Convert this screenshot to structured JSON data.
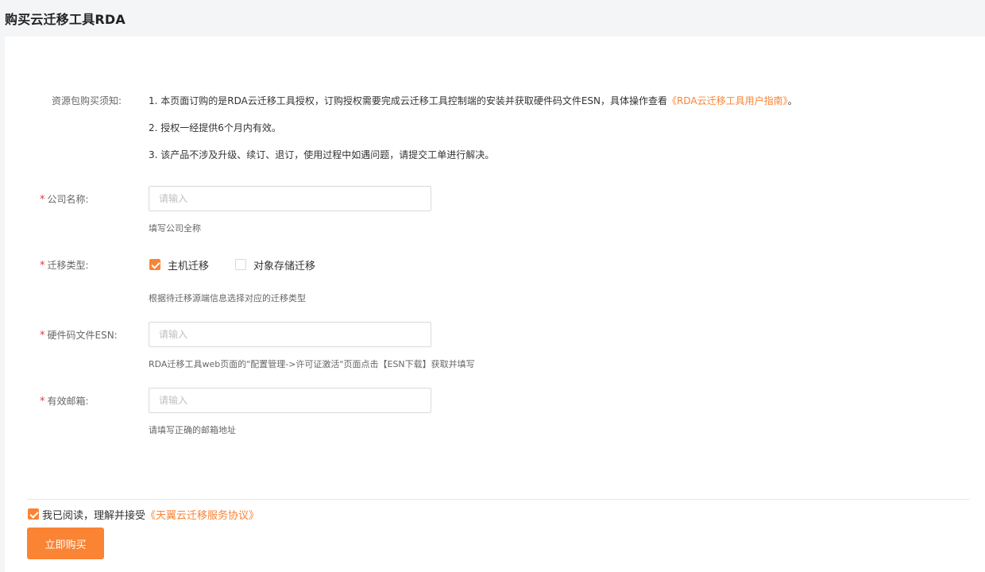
{
  "header": {
    "title": "购买云迁移工具RDA"
  },
  "notice": {
    "label": "资源包购买须知:",
    "line1_prefix": "1. 本页面订购的是RDA云迁移工具授权，订购授权需要完成云迁移工具控制端的安装并获取硬件码文件ESN，具体操作查看",
    "line1_link": "《RDA云迁移工具用户指南》",
    "line1_suffix": "。",
    "line2": "2. 授权一经提供6个月内有效。",
    "line3": "3. 该产品不涉及升级、续订、退订，使用过程中如遇问题，请提交工单进行解决。"
  },
  "form": {
    "required_mark": "*",
    "company": {
      "label": "公司名称:",
      "placeholder": "请输入",
      "value": "",
      "hint": "填写公司全称"
    },
    "migration_type": {
      "label": "迁移类型:",
      "options": [
        {
          "label": "主机迁移",
          "checked": true
        },
        {
          "label": "对象存储迁移",
          "checked": false
        }
      ],
      "hint": "根据待迁移源端信息选择对应的迁移类型"
    },
    "esn": {
      "label": "硬件码文件ESN:",
      "placeholder": "请输入",
      "value": "",
      "hint": "RDA迁移工具web页面的\"配置管理->许可证激活\"页面点击【ESN下载】获取并填写"
    },
    "email": {
      "label": "有效邮箱:",
      "placeholder": "请输入",
      "value": "",
      "hint": "请填写正确的邮箱地址"
    }
  },
  "footer": {
    "agree_checked": true,
    "agree_text": "我已阅读，理解并接受",
    "agree_link": "《天翼云迁移服务协议》",
    "buy_label": "立即购买"
  },
  "colors": {
    "accent": "#fa8334",
    "required": "#e4393c",
    "page_bg": "#f4f5f7"
  }
}
